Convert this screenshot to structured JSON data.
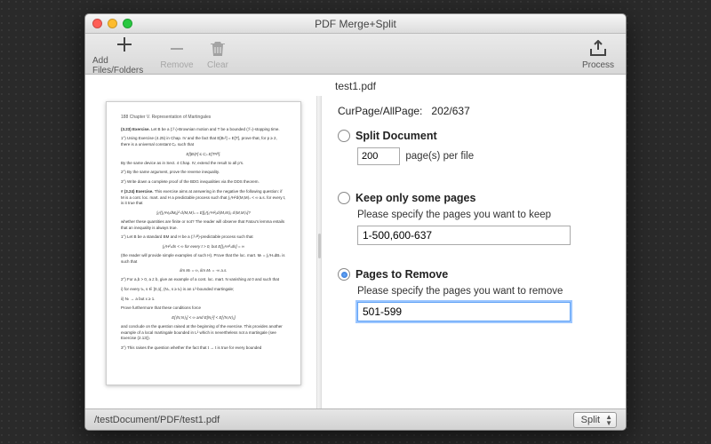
{
  "window": {
    "title": "PDF Merge+Split"
  },
  "toolbar": {
    "add_label": "Add Files/Folders",
    "remove_label": "Remove",
    "clear_label": "Clear",
    "process_label": "Process"
  },
  "document": {
    "filename": "test1.pdf",
    "path": "/testDocument/PDF/test1.pdf",
    "page_info_label": "CurPage/AllPage:",
    "page_info_value": "202/637"
  },
  "options": {
    "split": {
      "label": "Split  Document",
      "value": "200",
      "suffix": "page(s) per file",
      "selected": false
    },
    "keep": {
      "label": "Keep only some pages",
      "hint": "Please specify the pages you want to keep",
      "value": "1-500,600-637",
      "selected": false
    },
    "remove": {
      "label": "Pages to Remove",
      "hint": "Please specify the pages you want to remove",
      "value": "501-599",
      "selected": true
    }
  },
  "footer": {
    "action_select": "Split"
  },
  "preview": {
    "header": "188    Chapter V. Representation of Martingales",
    "p1_lead": "(3.23) Exercise.",
    "p1": " Let B be a (ℱₜ)-Brownian motion and T be a bounded (ℱₜ)-stopping time.",
    "p1b": "1°) Using Exercise (4.25) in Chap. IV and the fact that E[Bₜ²] = E[T], prove that, for p ≥ 2, there is a universal constant Cₚ such that",
    "eq1": "E[|Bₜ|ᵖ] ≤ Cₚ E[Tᵖ/²].",
    "p2": "By the same device as in Sect. 4 Chap. IV, extend the result to all p's.",
    "p2b": "2°) By the same argument, prove the reverse inequality.",
    "p2c": "3°) Write down a complete proof of the BDG inequalities via the DDS theorem.",
    "p3_lead": "(3.24) Exercise.",
    "p3": " This exercise aims at answering in the negative the following question: if M is a cont. loc. mart. and H a predictable process such that ∫₀ᵗH²d⟨M,M⟩ₛ < ∞ a.s. for every t, is it true that",
    "eq2": "∫₀ᵗ(∫₀ˢHᵤdMᵤ)² d⟨M,M⟩ₛ = E[∫₀ᵗ∫₀ˢH²ᵤd⟨M,M⟩ᵤ d⟨M,M⟩ₛ]?",
    "p4": "whether these quantities are finite or not? The reader will observe that Fatou's lemma entails that an inequality is always true.",
    "p5": "1°) Let B be a standard BM and H be a (ℱₜᴮ)-predictable process such that",
    "eq3": "∫₀ᵗH²ₛds < ∞ for every t > 0,   but  E[∫₀¹H²ₛds] = ∞",
    "p6": "(the reader will provide simple examples of such H). Prove that the loc. mart. Mₜ = ∫₀ᵗHₛdBₛ is such that",
    "eq4": "lim Mₜ = ∞,     lim Mₜ = -∞ a.s.",
    "p7": "2°) For a,b > 0, a ≠ b, give an example of a cont. loc. mart. N vanishing at 0 and such that",
    "p8": "i) for every tₙ, s ∈ ]0,1[, (Nₛ, s ≥ tₙ) is an L²-bounded martingale;",
    "p8b": "ii) Nₜ → a but x ≥ 1.",
    "p9": "Prove furthermore that these conditions force",
    "eq5": "E[⟨N,N⟩₁] < ∞  and  E[N₁²] < E[⟨N,N⟩₁]",
    "p10": "and conclude on the question raised at the beginning of the exercise. This provides another example of a local martingale bounded in L² which is nevertheless not a martingale (see Exercise (2.13)).",
    "p11": "3°) This raises the question whether the fact that t → t is true for every bounded"
  }
}
